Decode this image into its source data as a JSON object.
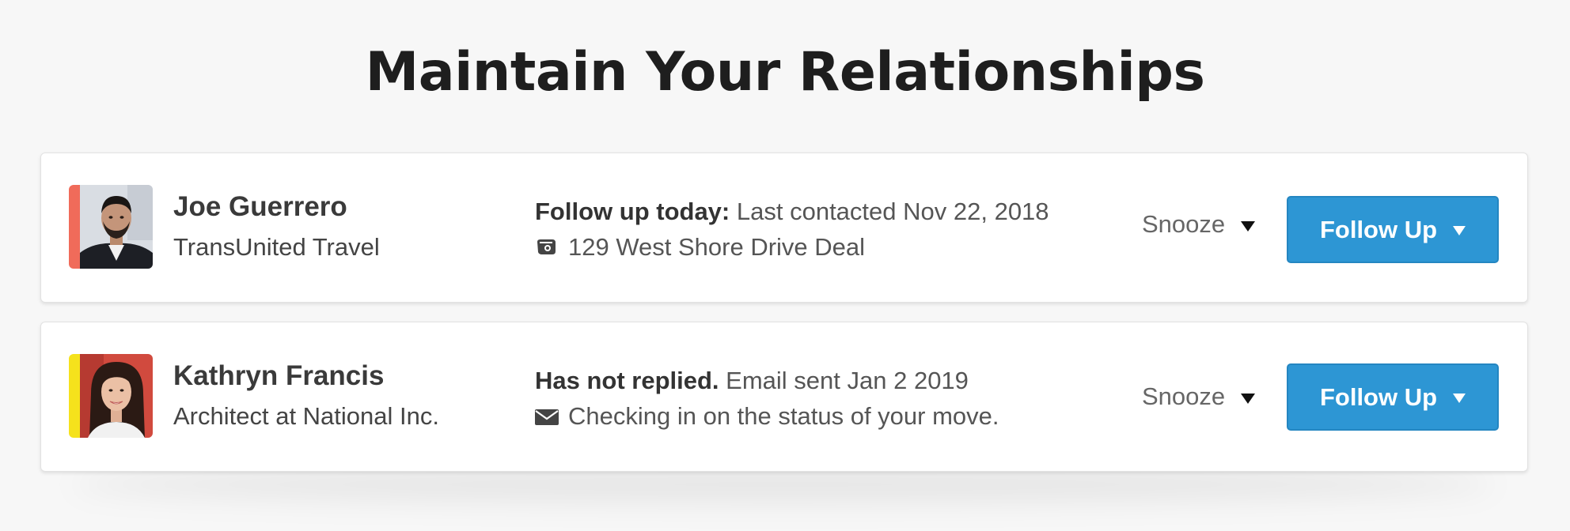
{
  "page": {
    "title": "Maintain Your Relationships"
  },
  "colors": {
    "background": "#f7f7f7",
    "accent_button": "#2d96d4",
    "stripe_contact_1": "#f06b5a",
    "stripe_contact_2": "#f5e21c"
  },
  "contacts": [
    {
      "name": "Joe Guerrero",
      "company": "TransUnited Travel",
      "status_strong": "Follow up today:",
      "status_text": "Last contacted Nov 22, 2018",
      "detail_icon": "deal-icon",
      "detail_text": "129 West Shore Drive Deal",
      "snooze_label": "Snooze",
      "follow_label": "Follow Up"
    },
    {
      "name": "Kathryn Francis",
      "company": "Architect at National Inc.",
      "status_strong": "Has not replied.",
      "status_text": "Email sent Jan 2 2019",
      "detail_icon": "envelope-icon",
      "detail_text": "Checking in on the status of your move.",
      "snooze_label": "Snooze",
      "follow_label": "Follow Up"
    }
  ]
}
